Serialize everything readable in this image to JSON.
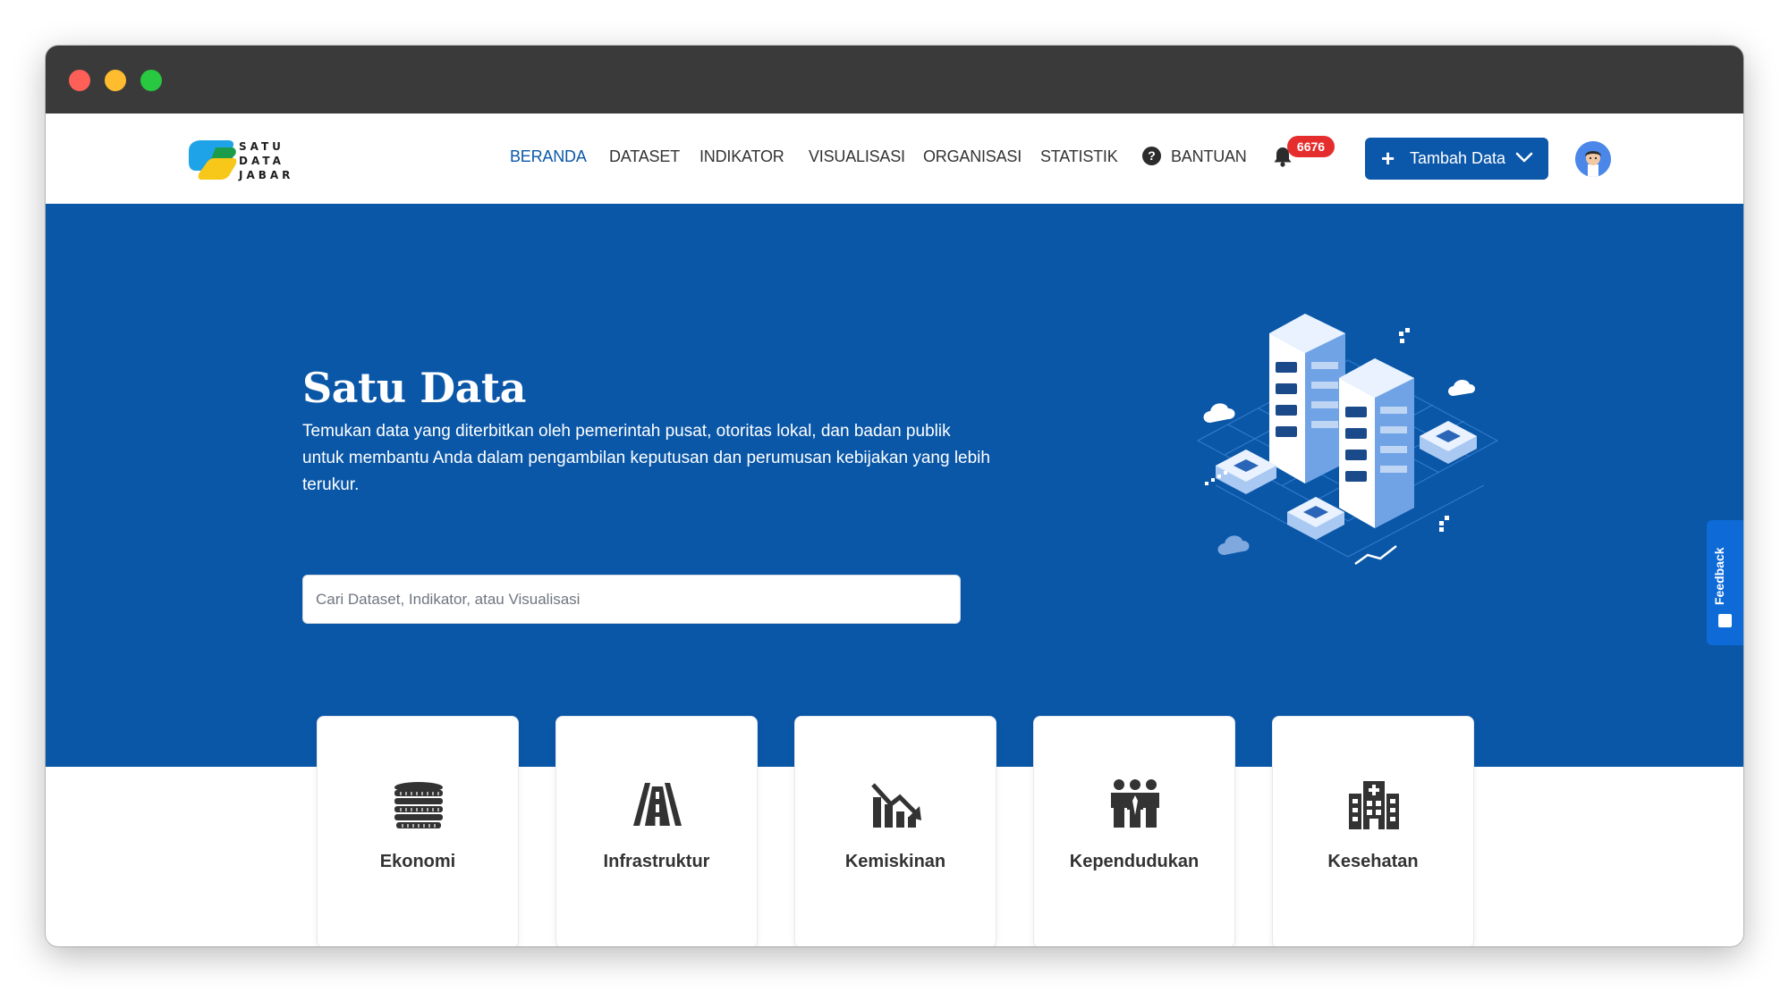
{
  "brand": {
    "logo_line1": "SATU",
    "logo_line2": "DATA",
    "logo_line3": "JABAR"
  },
  "nav": {
    "items": [
      {
        "label": "BERANDA",
        "active": true
      },
      {
        "label": "DATASET",
        "active": false
      },
      {
        "label": "INDIKATOR",
        "active": false
      },
      {
        "label": "VISUALISASI",
        "active": false
      },
      {
        "label": "ORGANISASI",
        "active": false
      },
      {
        "label": "STATISTIK",
        "active": false
      },
      {
        "label": "BANTUAN",
        "active": false
      }
    ],
    "help_icon": "?",
    "notification_count": "6676",
    "add_button_label": "Tambah Data"
  },
  "hero": {
    "title": "Satu Data",
    "description": "Temukan data yang diterbitkan oleh pemerintah pusat, otoritas lokal, dan badan publik untuk membantu Anda dalam pengambilan keputusan dan perumusan kebijakan yang lebih terukur.",
    "search_placeholder": "Cari Dataset, Indikator, atau Visualisasi"
  },
  "feedback": {
    "label": "Feedback"
  },
  "categories": [
    {
      "label": "Ekonomi",
      "icon": "coins-icon"
    },
    {
      "label": "Infrastruktur",
      "icon": "road-icon"
    },
    {
      "label": "Kemiskinan",
      "icon": "chart-decline-icon"
    },
    {
      "label": "Kependudukan",
      "icon": "people-icon"
    },
    {
      "label": "Kesehatan",
      "icon": "hospital-icon"
    }
  ],
  "colors": {
    "primary": "#0b57aa",
    "hero_bg": "#0a57a8",
    "badge": "#e52d2d",
    "feedback": "#0e6ad6",
    "titlebar": "#3a3a3a"
  }
}
